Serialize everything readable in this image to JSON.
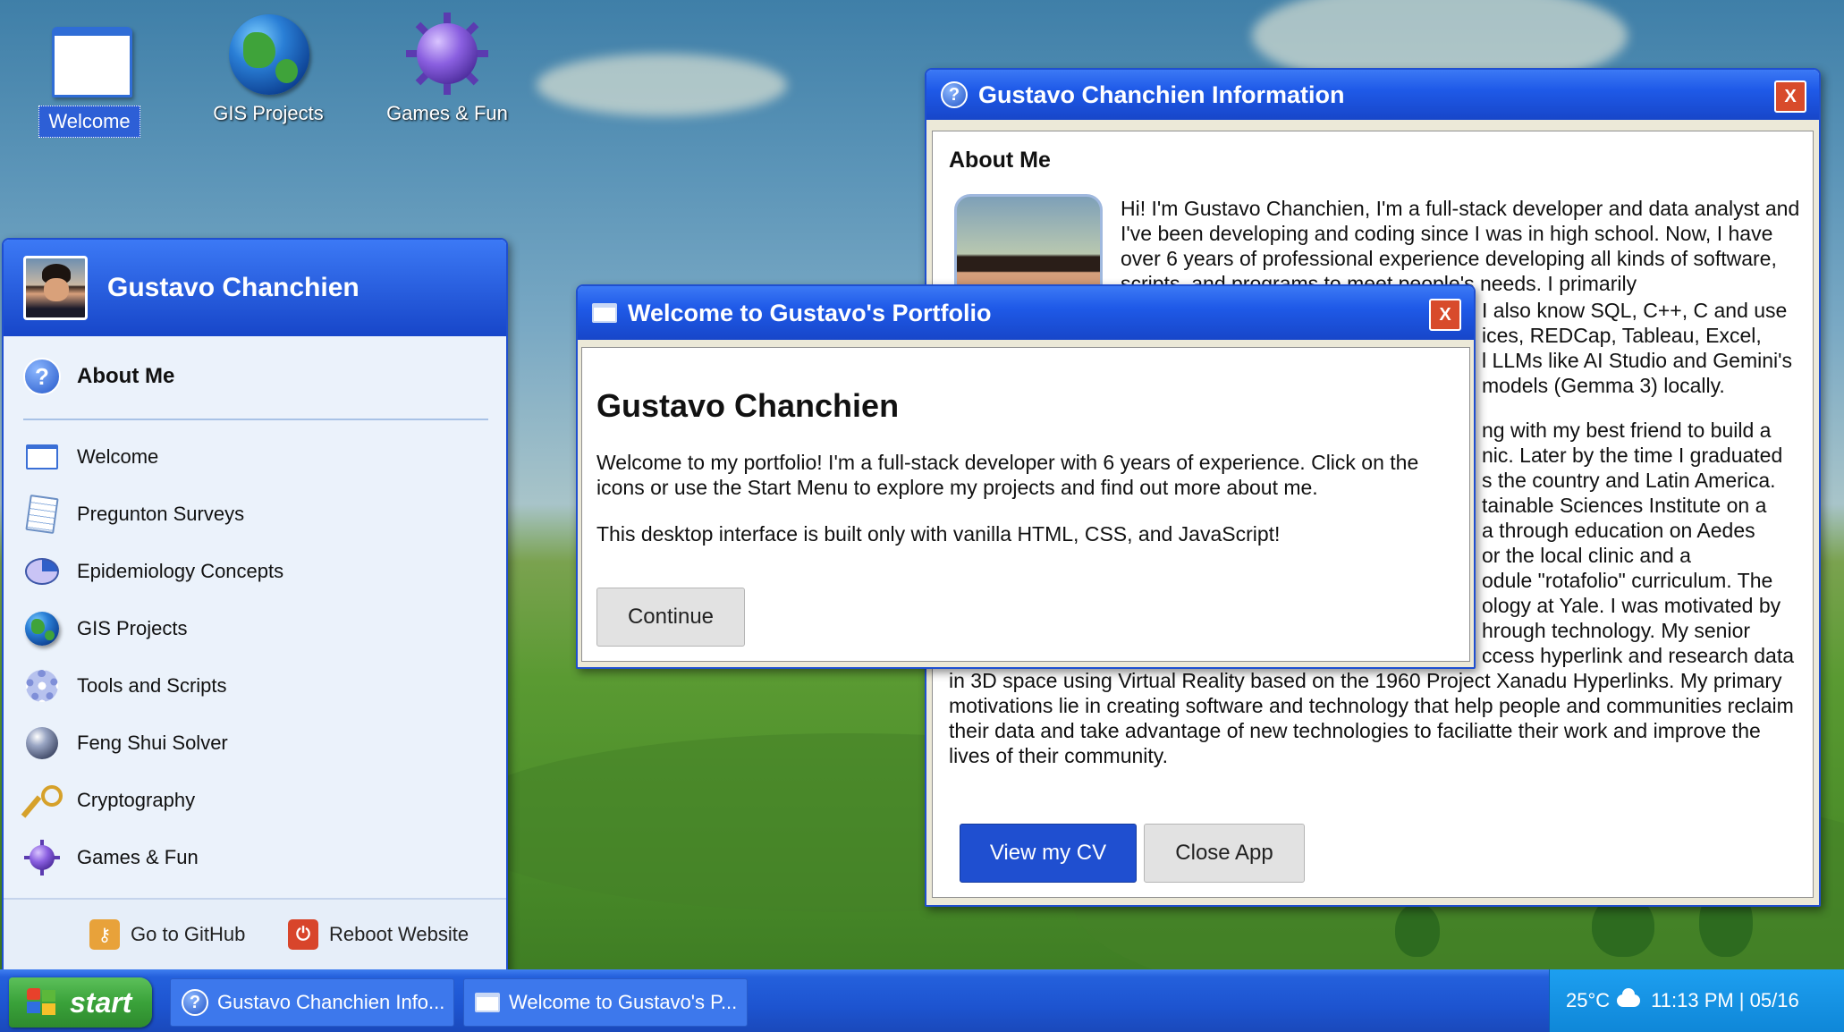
{
  "desktop": {
    "icons": [
      {
        "label": "Welcome",
        "icon": "window-icon"
      },
      {
        "label": "GIS Projects",
        "icon": "globe-icon"
      },
      {
        "label": "Games & Fun",
        "icon": "mine-icon"
      }
    ]
  },
  "info_window": {
    "title": "Gustavo Chanchien Information",
    "close_label": "X",
    "heading": "About Me",
    "paragraph1": "Hi! I'm Gustavo Chanchien, I'm a full-stack developer and data analyst and I've been developing and coding since I was in high school. Now, I have over 6 years of professional experience developing all kinds of software, scripts, and programs to meet people's needs. I primarily",
    "paragraph1_cont": [
      "I also know SQL, C++, C and use",
      "ices, REDCap, Tableau, Excel,",
      "l LLMs like AI Studio and Gemini's",
      "models (Gemma 3) locally."
    ],
    "paragraph2_partial": [
      "ng with my best friend to build a",
      "nic. Later by the time I graduated",
      "s the country and Latin America.",
      "tainable Sciences Institute on a",
      "a through education on Aedes",
      "or the local clinic and a",
      "odule \"rotafolio\" curriculum. The",
      "ology at Yale. I was motivated by",
      "hrough technology. My senior",
      "ccess hyperlink and research data"
    ],
    "paragraph2_end": "in 3D space using Virtual Reality based on the 1960 Project Xanadu Hyperlinks. My primary motivations lie in creating software and technology that help people and communities reclaim their data and take advantage of new technologies to faciliatte their work and improve the lives of their community.",
    "cv_button": "View my CV",
    "close_app_button": "Close App"
  },
  "welcome_dialog": {
    "title": "Welcome to Gustavo's Portfolio",
    "close_label": "X",
    "heading": "Gustavo Chanchien",
    "text1": "Welcome to my portfolio! I'm a full-stack developer with 6 years of experience. Click on the icons or use the Start Menu to explore my projects and find out more about me.",
    "text2": "This desktop interface is built only with vanilla HTML, CSS, and JavaScript!",
    "continue_button": "Continue"
  },
  "start_menu": {
    "user_name": "Gustavo Chanchien",
    "pinned": {
      "label": "About Me",
      "icon": "help-icon"
    },
    "items": [
      {
        "label": "Welcome",
        "icon": "window-icon"
      },
      {
        "label": "Pregunton Surveys",
        "icon": "notepad-icon"
      },
      {
        "label": "Epidemiology Concepts",
        "icon": "pie-chart-icon"
      },
      {
        "label": "GIS Projects",
        "icon": "globe-icon"
      },
      {
        "label": "Tools and Scripts",
        "icon": "gear-icon"
      },
      {
        "label": "Feng Shui Solver",
        "icon": "sphere-icon"
      },
      {
        "label": "Cryptography",
        "icon": "key-icon"
      },
      {
        "label": "Games & Fun",
        "icon": "mine-icon"
      }
    ],
    "footer": {
      "github": "Go to GitHub",
      "reboot": "Reboot Website"
    }
  },
  "taskbar": {
    "start_label": "start",
    "tasks": [
      {
        "label": "Gustavo Chanchien Info...",
        "icon": "help-icon"
      },
      {
        "label": "Welcome to Gustavo's P...",
        "icon": "window-icon"
      }
    ],
    "weather": "25°C",
    "clock": "11:13 PM | 05/16"
  },
  "colors": {
    "titlebar": "#1f5ae8",
    "primary_button": "#1f4fd0",
    "close_button": "#d84b2b",
    "start_button": "#3aa23a"
  }
}
